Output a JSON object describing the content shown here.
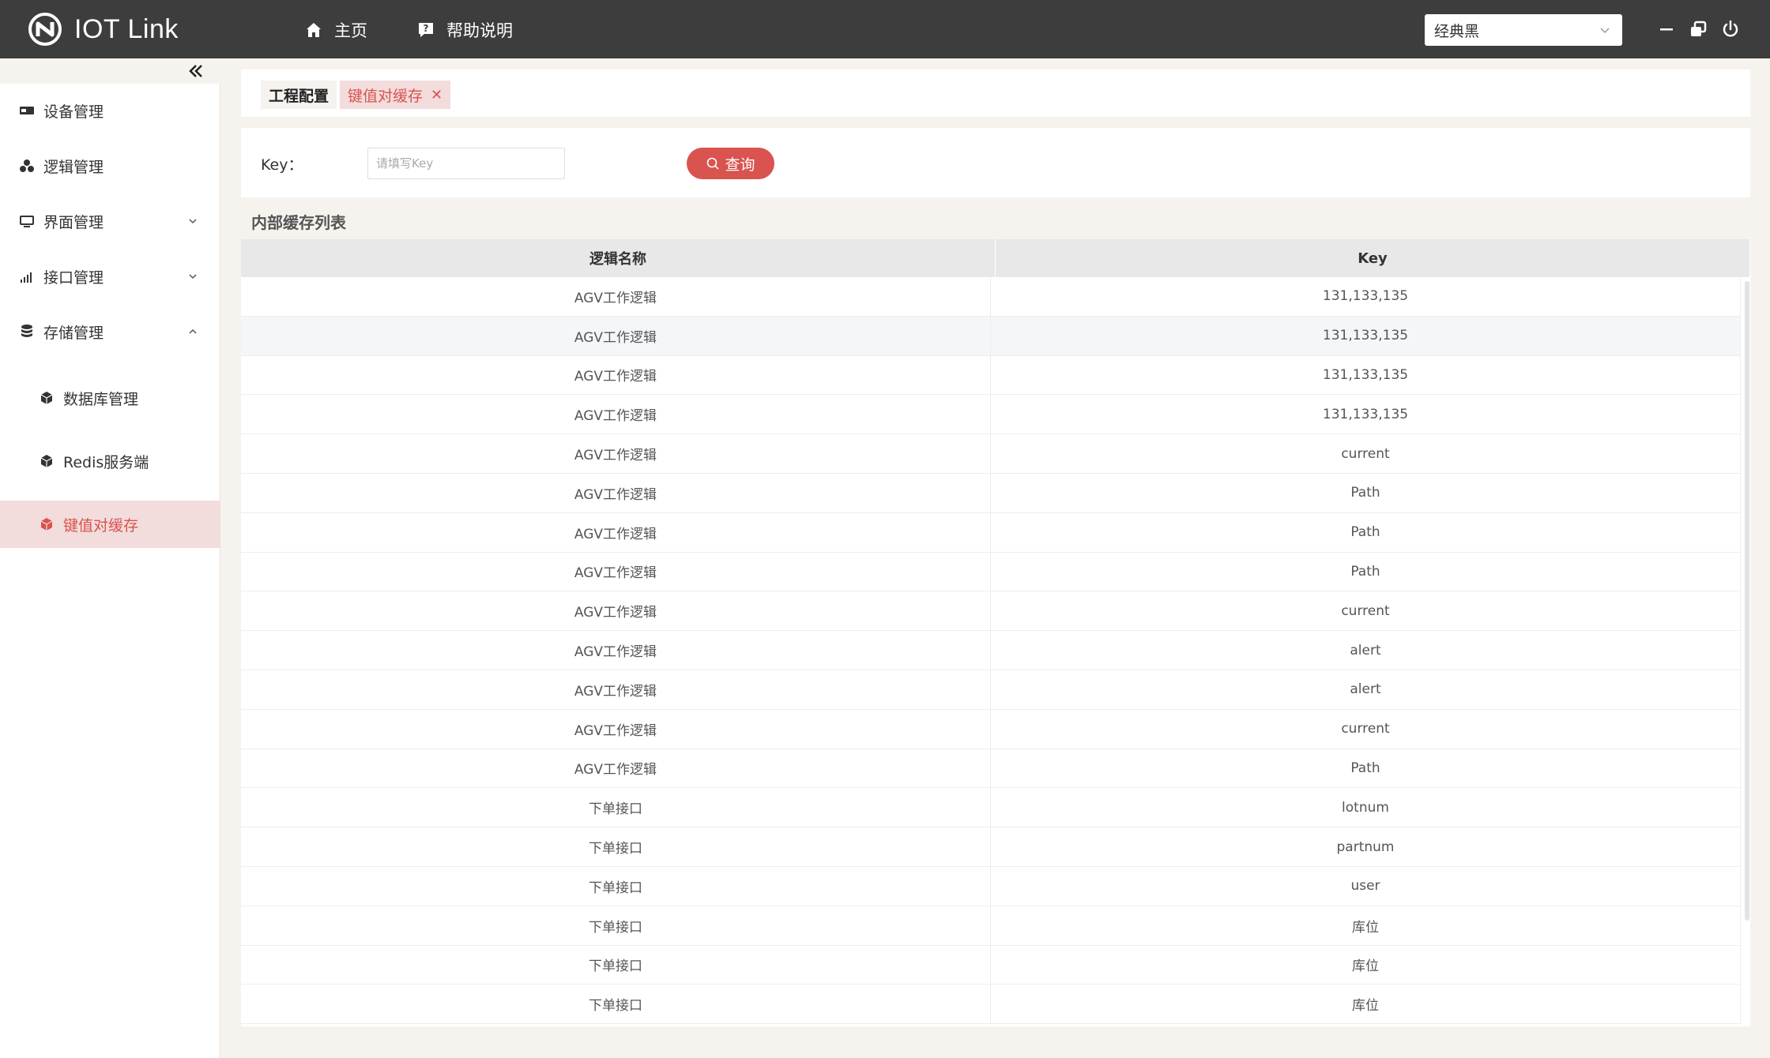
{
  "app": {
    "title": "IOT Link",
    "nav": [
      {
        "label": "主页",
        "icon": "home-icon"
      },
      {
        "label": "帮助说明",
        "icon": "help-icon"
      }
    ],
    "theme": "经典黑"
  },
  "sidebar": {
    "menu": [
      {
        "label": "设备管理",
        "icon": "device-icon"
      },
      {
        "label": "逻辑管理",
        "icon": "logic-icon"
      },
      {
        "label": "界面管理",
        "icon": "monitor-icon"
      },
      {
        "label": "接口管理",
        "icon": "signal-icon"
      },
      {
        "label": "存储管理",
        "icon": "database-icon"
      }
    ],
    "submenu": [
      {
        "label": "数据库管理",
        "icon": "cube-icon"
      },
      {
        "label": "Redis服务端",
        "icon": "cube-icon"
      },
      {
        "label": "键值对缓存",
        "icon": "cube-icon",
        "active": true
      }
    ]
  },
  "tabs": [
    {
      "label": "工程配置"
    },
    {
      "label": "键值对缓存",
      "closable": true
    }
  ],
  "search": {
    "label": "Key：",
    "placeholder": "请填写Key",
    "value": "",
    "button": "查询"
  },
  "table": {
    "title": "内部缓存列表",
    "columns": [
      "逻辑名称",
      "Key"
    ],
    "rows": [
      [
        "AGV工作逻辑",
        "131,133,135"
      ],
      [
        "AGV工作逻辑",
        "131,133,135"
      ],
      [
        "AGV工作逻辑",
        "131,133,135"
      ],
      [
        "AGV工作逻辑",
        "131,133,135"
      ],
      [
        "AGV工作逻辑",
        "current"
      ],
      [
        "AGV工作逻辑",
        "Path"
      ],
      [
        "AGV工作逻辑",
        "Path"
      ],
      [
        "AGV工作逻辑",
        "Path"
      ],
      [
        "AGV工作逻辑",
        "current"
      ],
      [
        "AGV工作逻辑",
        "alert"
      ],
      [
        "AGV工作逻辑",
        "alert"
      ],
      [
        "AGV工作逻辑",
        "current"
      ],
      [
        "AGV工作逻辑",
        "Path"
      ],
      [
        "下单接口",
        "lotnum"
      ],
      [
        "下单接口",
        "partnum"
      ],
      [
        "下单接口",
        "user"
      ],
      [
        "下单接口",
        "库位"
      ],
      [
        "下单接口",
        "库位"
      ],
      [
        "下单接口",
        "库位"
      ]
    ]
  },
  "colors": {
    "header": "#3d3d3d",
    "accent": "#d9534f",
    "active_bg": "#f2dcdc"
  }
}
